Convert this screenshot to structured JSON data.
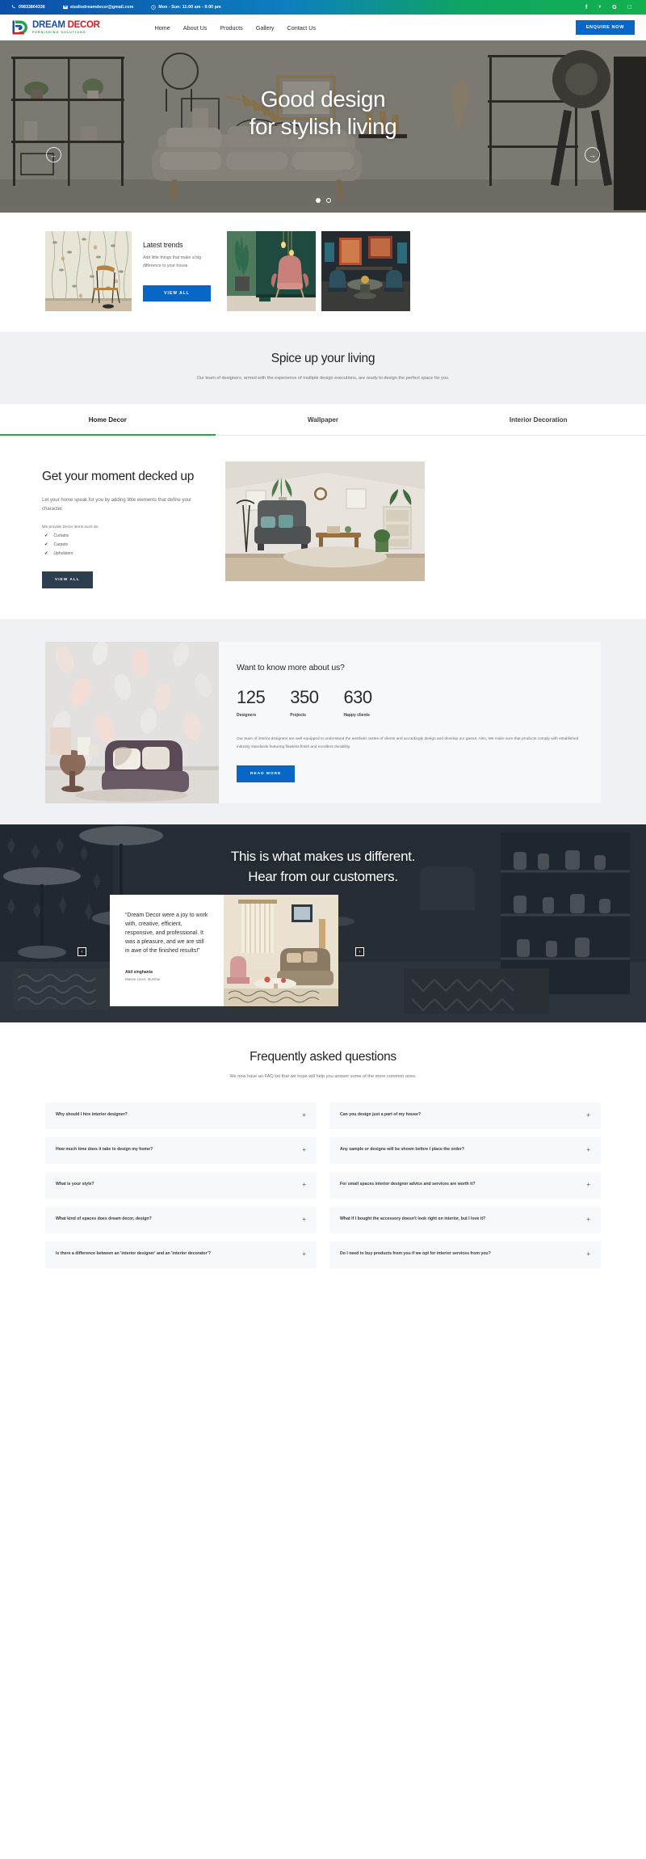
{
  "topbar": {
    "phone": "09833804336",
    "email": "studiodreamdecor@gmail.com",
    "hours": "Mon - Sun: 11:00 am - 9:00 pm",
    "social": [
      {
        "name": "facebook-icon",
        "glyph": "f"
      },
      {
        "name": "twitter-icon",
        "glyph": "ᵛ"
      },
      {
        "name": "google-icon",
        "glyph": "G"
      },
      {
        "name": "instagram-icon",
        "glyph": "□"
      }
    ],
    "gradient_from": "#0b4fa8",
    "gradient_to": "#12b14e"
  },
  "nav": {
    "logo_word1": "DREAM",
    "logo_word2": "DECOR",
    "logo_tagline": "FURNISHING SOLUTIONS",
    "links": [
      "Home",
      "About Us",
      "Products",
      "Gallery",
      "Contact Us"
    ],
    "cta": "ENQUIRE NOW",
    "cta_color": "#0867c6"
  },
  "hero": {
    "line1": "Good design",
    "line2": "for stylish living",
    "prev": "←",
    "next": "→",
    "slides": 2,
    "active_slide": 1
  },
  "trends": {
    "title": "Latest trends",
    "body": "Add little things that make a big difference to your house",
    "button": "VIEW ALL"
  },
  "spice": {
    "title": "Spice up your living",
    "body": "Our team of designers, armed with the experience of multiple design executions, are ready to design the perfect space for you.",
    "tabs": [
      "Home Decor",
      "Wallpaper",
      "Interior Decoration"
    ],
    "active_tab": "Home Decor",
    "active_underline": "#27a745"
  },
  "decked": {
    "title": "Get your moment decked up",
    "body": "Let your home speak for you by adding little elements that define your character.",
    "provide_label": "We provide Decor items such as:",
    "items": [
      "Curtains",
      "Carpets",
      "Upholsters"
    ],
    "button": "VIEW ALL"
  },
  "about": {
    "title": "Want to know more about us?",
    "stats": [
      {
        "number": "125",
        "label": "Designers"
      },
      {
        "number": "350",
        "label": "Projects"
      },
      {
        "number": "630",
        "label": "Happy clients"
      }
    ],
    "body": "Our team of interior designers are well-equipped to understand the aesthetic tastes of clients and accordingly design and develop our gamut. Also, We make sure that products comply with established industry standards featuring flawless finish and excellent durability.",
    "button": "READ MORE"
  },
  "testimonial": {
    "heading_line1": "This is what makes us different.",
    "heading_line2": "Hear from our customers.",
    "quote": "“Dream Decor were a joy to work with, creative, efficient, responsive, and professional. It was a pleasure, and we are still in awe of the finished results!”",
    "name": "Akil singhania",
    "location": "Marine Lines, Mumbai",
    "prev": "‹",
    "next": "›"
  },
  "faq": {
    "title": "Frequently asked questions",
    "subtitle": "We now have an FAQ list that we hope will help you answer some of the more common ones.",
    "toggle": "+",
    "left": [
      "Why should I hire interior designer?",
      "How much time does it take to design my home?",
      "What is your style?",
      "What kind of spaces does dream decor, design?",
      "Is there a difference between an 'interior designer' and an 'interior decorator'?"
    ],
    "right": [
      "Can you design just a part of my house?",
      "Any sample or designs will be shown before I place the order?",
      "For small spaces interior designer advice and services are worth it?",
      "What if I bought the accessory doesn't look right on interior, but I love it?",
      "Do I need to buy products from you if we opt for interior services from you?"
    ]
  }
}
